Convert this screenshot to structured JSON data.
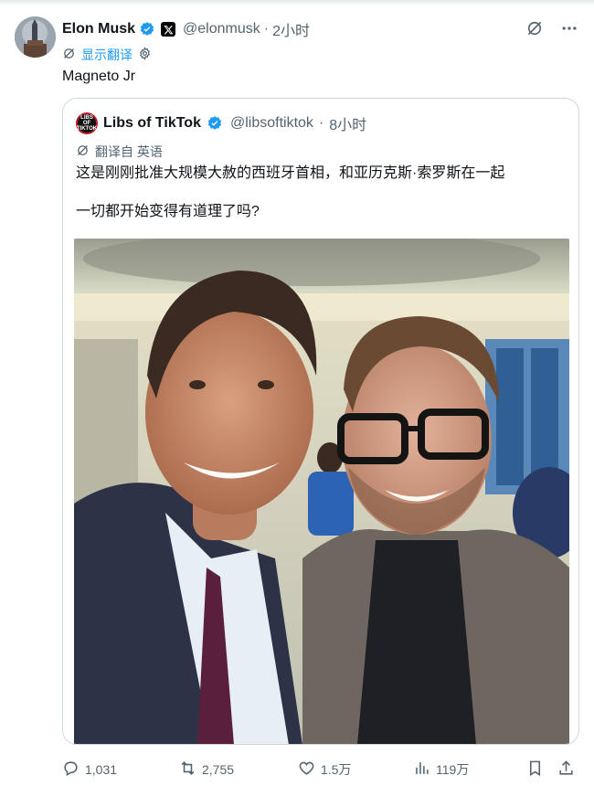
{
  "tweet": {
    "author_name": "Elon Musk",
    "author_handle": "@elonmusk",
    "time": "2小时",
    "translate_label": "显示翻译",
    "text": "Magneto Jr"
  },
  "quote": {
    "author_name": "Libs of TikTok",
    "author_handle": "@libsoftiktok",
    "time": "8小时",
    "avatar_text": "LIBS OF TIKTOK",
    "translated_from": "翻译自 英语",
    "text_line1": "这是刚刚批准大规模大赦的西班牙首相，和亚历克斯·索罗斯在一起",
    "text_line2": "一切都开始变得有道理了吗?"
  },
  "actions": {
    "replies": "1,031",
    "reposts": "2,755",
    "likes": "1.5万",
    "views": "119万"
  },
  "colors": {
    "accent": "#1d9bf0",
    "muted": "#536471",
    "border": "#cfd9de",
    "verified": "#1d9bf0"
  },
  "icons": [
    "verified-badge-icon",
    "x-logo-icon",
    "grok-icon",
    "more-icon",
    "translate-icon",
    "settings-icon",
    "reply-icon",
    "repost-icon",
    "like-icon",
    "views-icon",
    "bookmark-icon",
    "share-icon"
  ]
}
